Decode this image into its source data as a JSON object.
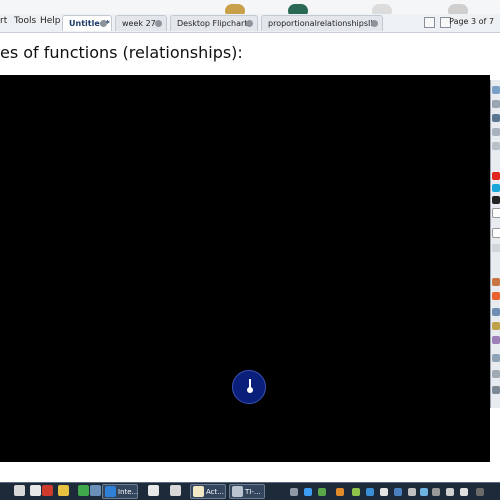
{
  "menu": {
    "items": [
      "rt",
      "Tools",
      "Help"
    ]
  },
  "tabs": [
    {
      "label": "Untitled*",
      "active": true
    },
    {
      "label": "week 27a",
      "active": false
    },
    {
      "label": "Desktop Flipchart*",
      "active": false
    },
    {
      "label": "proportionalrelationshipsII*",
      "active": false
    }
  ],
  "page_indicator": "Page 3 of 7",
  "page_title": "es of functions (relationships):",
  "taskbar": {
    "buttons": [
      {
        "label": "Inte..."
      },
      {
        "label": "Act..."
      },
      {
        "label": "TI-..."
      }
    ]
  },
  "colors": {
    "canvas": "#000000",
    "clock_face": "#0a1f7a",
    "taskbar": "#1d2a3a",
    "active_tab_text": "#1a3a6a"
  }
}
